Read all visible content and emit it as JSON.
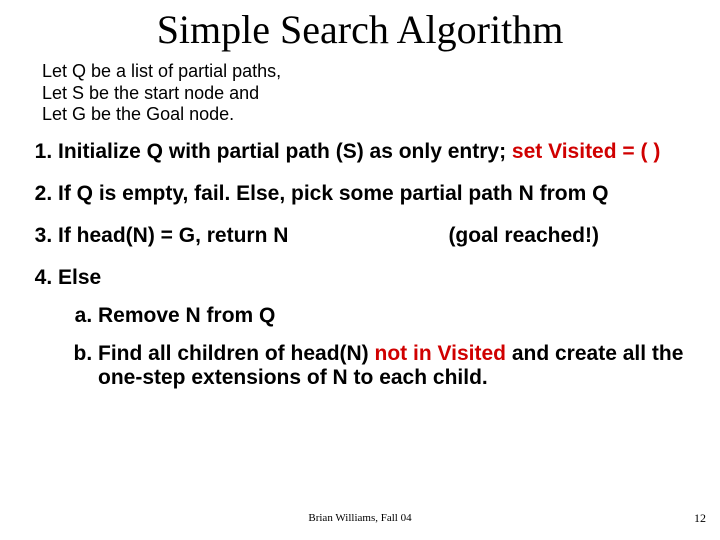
{
  "title": "Simple Search Algorithm",
  "intro_line1": "Let Q be a list of partial paths,",
  "intro_line2": "Let S be the start node and",
  "intro_line3": "Let G be the Goal node.",
  "step1_a": "Initialize Q with partial path (S) as only entry; ",
  "step1_b": "set Visited = ( )",
  "step2": "If Q is empty, fail.  Else, pick some partial path N from Q",
  "step3_a": "If head(N) = G, return N",
  "step3_b": "(goal reached!)",
  "step4": "Else",
  "step4a": "Remove N from Q",
  "step4b_a": "Find all children of head(N) ",
  "step4b_b": "not in Visited",
  "step4b_c": " and create all the one-step extensions of N to each child.",
  "footer_center": "Brian Williams, Fall 04",
  "footer_right": "12"
}
